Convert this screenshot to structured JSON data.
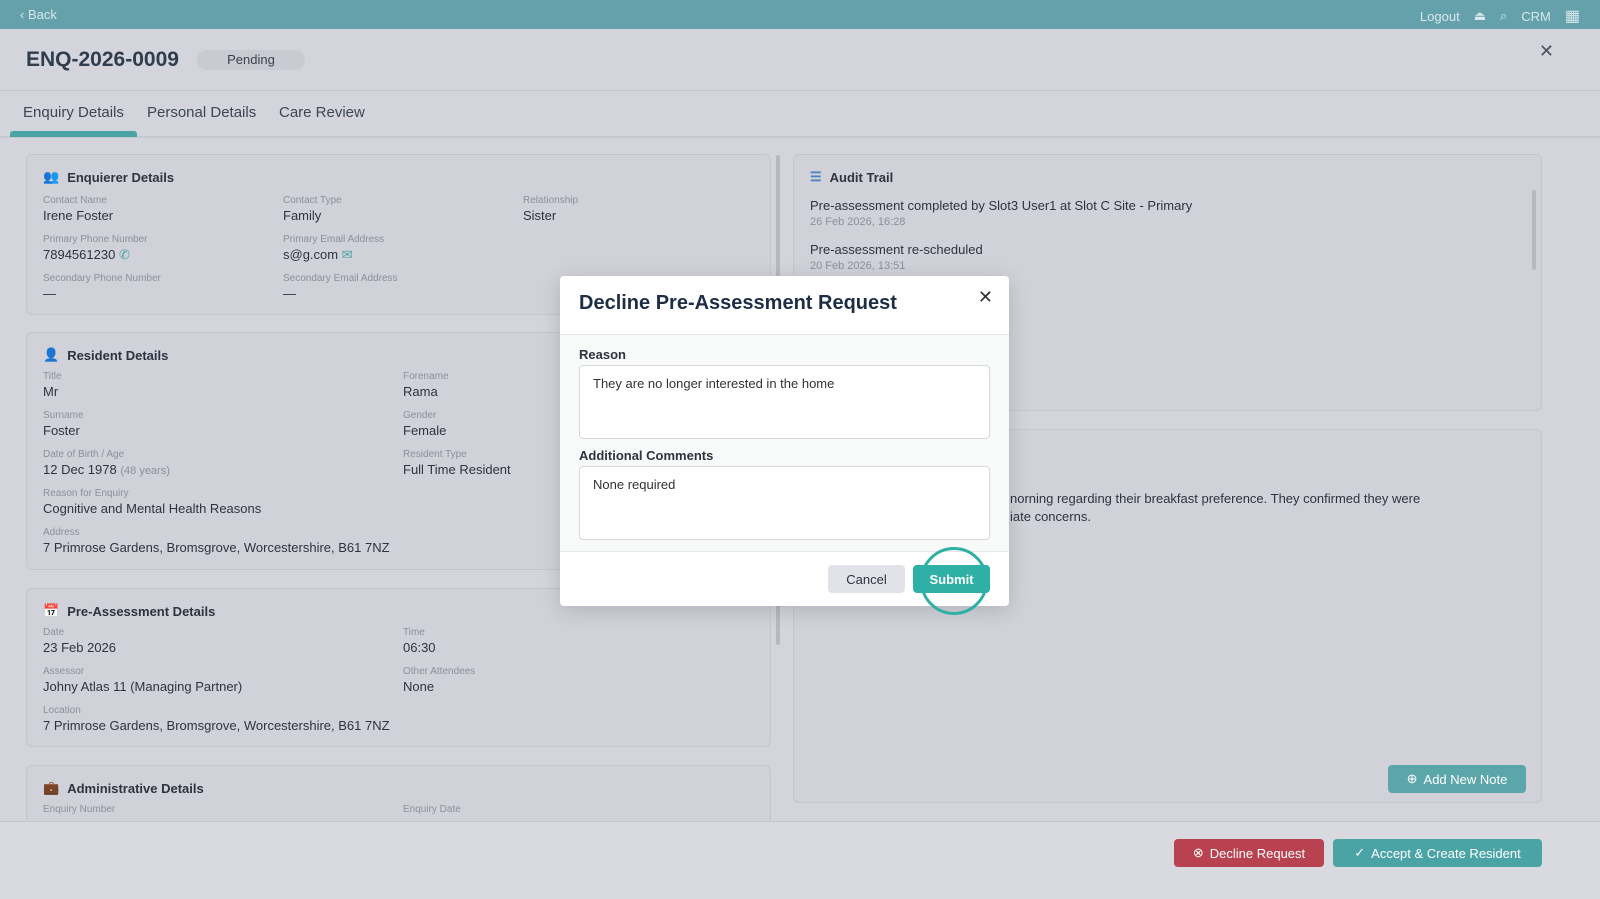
{
  "topbar": {
    "back": "‹ Back",
    "logout": "Logout",
    "crm": "CRM"
  },
  "header": {
    "title": "ENQ-2026-0009",
    "status": "Pending"
  },
  "tabs": [
    "Enquiry Details",
    "Personal Details",
    "Care Review"
  ],
  "enquirer": {
    "title": "Enquierer Details",
    "fields": [
      {
        "label": "Contact Name",
        "value": "Irene Foster"
      },
      {
        "label": "Contact Type",
        "value": "Family"
      },
      {
        "label": "Relationship",
        "value": "Sister"
      },
      {
        "label": "Primary Phone Number",
        "value": "7894561230"
      },
      {
        "label": "Primary Email Address",
        "value": "s@g.com"
      },
      {
        "label": "Secondary Phone Number",
        "value": "—"
      },
      {
        "label": "Secondary Email Address",
        "value": "—"
      }
    ]
  },
  "resident": {
    "title": "Resident Details",
    "fields": [
      {
        "label": "Title",
        "value": "Mr"
      },
      {
        "label": "Forename",
        "value": "Rama"
      },
      {
        "label": "Surname",
        "value": "Foster"
      },
      {
        "label": "Gender",
        "value": "Female"
      },
      {
        "label": "Date of Birth / Age",
        "value": "12 Dec 1978",
        "extra": "(48 years)"
      },
      {
        "label": "Resident Type",
        "value": "Full Time Resident"
      },
      {
        "label": "Reason for Enquiry",
        "value": "Cognitive and Mental Health Reasons"
      },
      {
        "label": "Address",
        "value": "7 Primrose Gardens, Bromsgrove, Worcestershire, B61 7NZ"
      }
    ]
  },
  "preassessment": {
    "title": "Pre-Assessment Details",
    "fields": [
      {
        "label": "Date",
        "value": "23 Feb 2026"
      },
      {
        "label": "Time",
        "value": "06:30"
      },
      {
        "label": "Assessor",
        "value": "Johny Atlas 11 (Managing Partner)"
      },
      {
        "label": "Other Attendees",
        "value": "None"
      },
      {
        "label": "Location",
        "value": "7 Primrose Gardens, Bromsgrove, Worcestershire, B61 7NZ"
      }
    ]
  },
  "admin": {
    "title": "Administrative Details",
    "fields": [
      {
        "label": "Enquiry Number"
      },
      {
        "label": "Enquiry Date"
      }
    ]
  },
  "audit": {
    "title": "Audit Trail",
    "items": [
      {
        "text": "Pre-assessment completed by Slot3 User1 at Slot C Site - Primary",
        "time": "26 Feb 2026, 16:28"
      },
      {
        "text": "Pre-assessment re-scheduled",
        "time": "20 Feb 2026, 13:51"
      }
    ]
  },
  "notes": {
    "line1": "norning regarding their breakfast preference. They confirmed they were",
    "line2": "iate concerns.",
    "add": "Add New Note"
  },
  "footer": {
    "decline": "Decline Request",
    "accept": "Accept & Create Resident"
  },
  "modal": {
    "title": "Decline Pre-Assessment Request",
    "reason_label": "Reason",
    "reason": "They are no longer interested in the home",
    "comments_label": "Additional Comments",
    "comments": "None required",
    "cancel": "Cancel",
    "submit": "Submit"
  }
}
